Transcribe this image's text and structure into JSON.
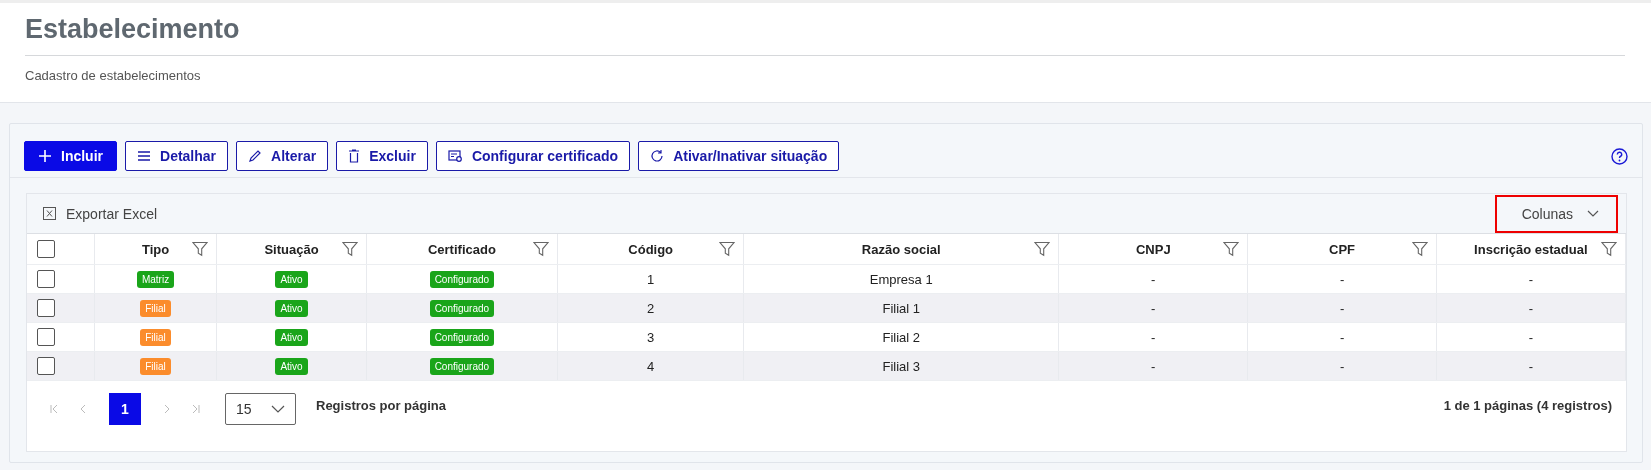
{
  "header": {
    "title": "Estabelecimento",
    "subtitle": "Cadastro de estabelecimentos"
  },
  "toolbar": {
    "buttons": [
      {
        "label": "Incluir",
        "kind": "plus",
        "primary": true
      },
      {
        "label": "Detalhar",
        "kind": "list",
        "primary": false
      },
      {
        "label": "Alterar",
        "kind": "pencil",
        "primary": false
      },
      {
        "label": "Excluir",
        "kind": "trash",
        "primary": false
      },
      {
        "label": "Configurar certificado",
        "kind": "certificate",
        "primary": false
      },
      {
        "label": "Ativar/Inativar situação",
        "kind": "refresh",
        "primary": false
      }
    ]
  },
  "grid": {
    "export_label": "Exportar Excel",
    "columns_button": "Colunas",
    "select_all": {
      "checked": false
    },
    "columns": [
      {
        "label": "Tipo"
      },
      {
        "label": "Situação"
      },
      {
        "label": "Certificado"
      },
      {
        "label": "Código"
      },
      {
        "label": "Razão social"
      },
      {
        "label": "CNPJ"
      },
      {
        "label": "CPF"
      },
      {
        "label": "Inscrição estadual"
      }
    ],
    "rows": [
      {
        "checked": false,
        "tipo": {
          "text": "Matriz",
          "color": "#1aa51a"
        },
        "situacao": {
          "text": "Ativo",
          "color": "#1aa51a"
        },
        "certificado": {
          "text": "Configurado",
          "color": "#1aa51a"
        },
        "codigo": "1",
        "razao_social": "Empresa 1",
        "cnpj": "-",
        "cpf": "-",
        "inscricao_estadual": "-"
      },
      {
        "checked": false,
        "tipo": {
          "text": "Filial",
          "color": "#fb8c2c"
        },
        "situacao": {
          "text": "Ativo",
          "color": "#1aa51a"
        },
        "certificado": {
          "text": "Configurado",
          "color": "#1aa51a"
        },
        "codigo": "2",
        "razao_social": "Filial 1",
        "cnpj": "-",
        "cpf": "-",
        "inscricao_estadual": "-"
      },
      {
        "checked": false,
        "tipo": {
          "text": "Filial",
          "color": "#fb8c2c"
        },
        "situacao": {
          "text": "Ativo",
          "color": "#1aa51a"
        },
        "certificado": {
          "text": "Configurado",
          "color": "#1aa51a"
        },
        "codigo": "3",
        "razao_social": "Filial 2",
        "cnpj": "-",
        "cpf": "-",
        "inscricao_estadual": "-"
      },
      {
        "checked": false,
        "tipo": {
          "text": "Filial",
          "color": "#fb8c2c"
        },
        "situacao": {
          "text": "Ativo",
          "color": "#1aa51a"
        },
        "certificado": {
          "text": "Configurado",
          "color": "#1aa51a"
        },
        "codigo": "4",
        "razao_social": "Filial 3",
        "cnpj": "-",
        "cpf": "-",
        "inscricao_estadual": "-"
      }
    ]
  },
  "pagination": {
    "pages": [
      {
        "label": "1",
        "selected": true
      }
    ],
    "page_size": "15",
    "page_size_label": "Registros por página",
    "summary": "1 de 1 páginas (4 registros)"
  }
}
